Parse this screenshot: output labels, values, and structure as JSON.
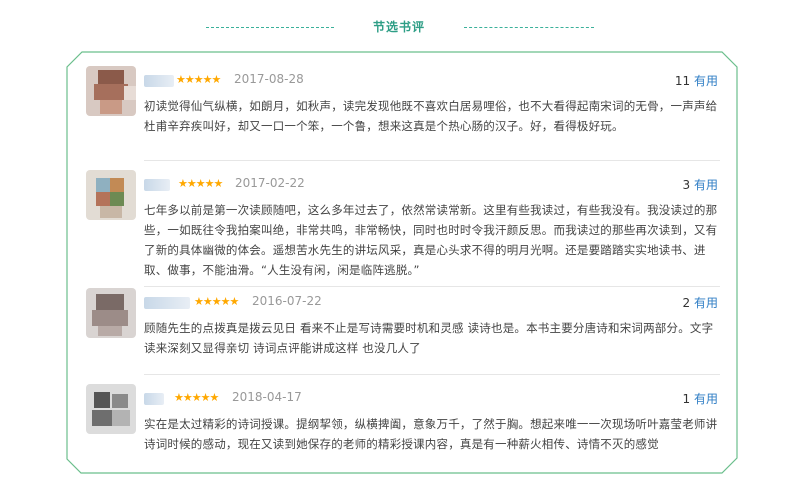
{
  "section": {
    "title": "节选书评"
  },
  "colors": {
    "accent": "#2e9e86",
    "frame": "#6bbf8c",
    "link": "#2f7ec5",
    "star": "#ffa800"
  },
  "reviews": [
    {
      "stars": "★★★★★",
      "rating": 5,
      "date": "2017-08-28",
      "useful_count": "11",
      "useful_label": "有用",
      "content": "初读觉得仙气纵横，如朗月，如秋声，读完发现他既不喜欢白居易哩俗，也不大看得起南宋词的无骨，一声声给杜甫辛弃疾叫好，却又一口一个笨，一个鲁，想来这真是个热心肠的汉子。好，看得极好玩。"
    },
    {
      "stars": "★★★★★",
      "rating": 5,
      "date": "2017-02-22",
      "useful_count": "3",
      "useful_label": "有用",
      "content": "七年多以前是第一次读顾随吧，这么多年过去了，依然常读常新。这里有些我读过，有些我没有。我没读过的那些，一如既往令我拍案叫绝，非常共鸣，非常畅快，同时也时时令我汗颜反思。而我读过的那些再次读到，又有了新的具体幽微的体会。遥想苦水先生的讲坛风采，真是心头求不得的明月光啊。还是要踏踏实实地读书、进取、做事，不能油滑。“人生没有闲，闲是临阵逃脱。”"
    },
    {
      "stars": "★★★★★",
      "rating": 5,
      "date": "2016-07-22",
      "useful_count": "2",
      "useful_label": "有用",
      "content": "顾随先生的点拨真是拨云见日 看来不止是写诗需要时机和灵感 读诗也是。本书主要分唐诗和宋词两部分。文字读来深刻又显得亲切 诗词点评能讲成这样 也没几人了"
    },
    {
      "stars": "★★★★★",
      "rating": 5,
      "date": "2018-04-17",
      "useful_count": "1",
      "useful_label": "有用",
      "content": "实在是太过精彩的诗词授课。提纲挈领，纵横捭阖，意象万千，了然于胸。想起来唯一一次现场听叶嘉莹老师讲诗词时候的感动，现在又读到她保存的老师的精彩授课内容，真是有一种薪火相传、诗情不灭的感觉"
    }
  ]
}
